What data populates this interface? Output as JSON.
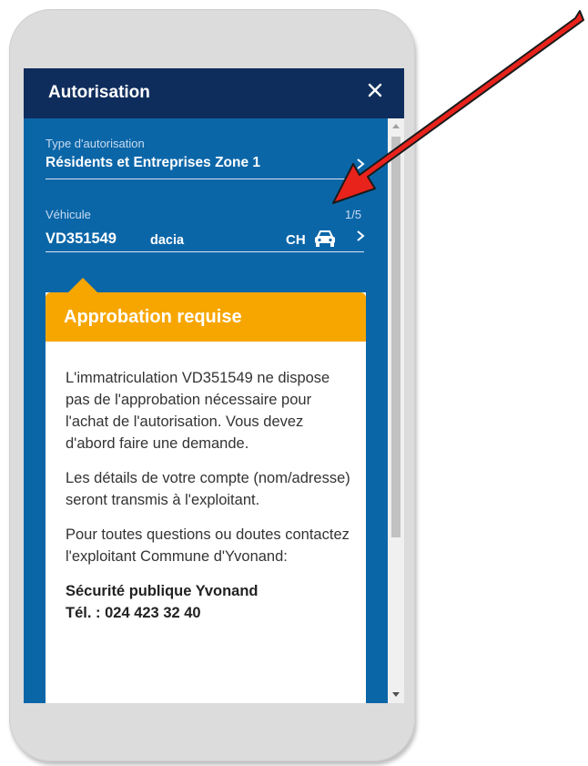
{
  "dialog": {
    "title": "Autorisation",
    "close_icon": "close-icon"
  },
  "authorization_type": {
    "label": "Type d'autorisation",
    "value": "Résidents et Entreprises Zone 1"
  },
  "vehicle": {
    "label": "Véhicule",
    "counter": "1/5",
    "plate": "VD351549",
    "model": "dacia",
    "country": "CH",
    "icon": "car-icon"
  },
  "approval_card": {
    "title": "Approbation requise",
    "paragraphs": [
      "L'immatriculation VD351549 ne dispose pas de l'approbation nécessaire pour l'achat de l'autorisation. Vous devez d'abord faire une demande.",
      "Les détails de votre compte (nom/adresse) seront transmis à l'exploitant.",
      "Pour toutes questions ou doutes contactez l'exploitant Commune d'Yvonand:"
    ],
    "contact_name": "Sécurité publique Yvonand",
    "contact_phone": "Tél. : 024 423 32 40"
  },
  "colors": {
    "header": "#0f2d5c",
    "background": "#0b66a8",
    "accent": "#f7a600",
    "annotation": "#e8231c"
  }
}
